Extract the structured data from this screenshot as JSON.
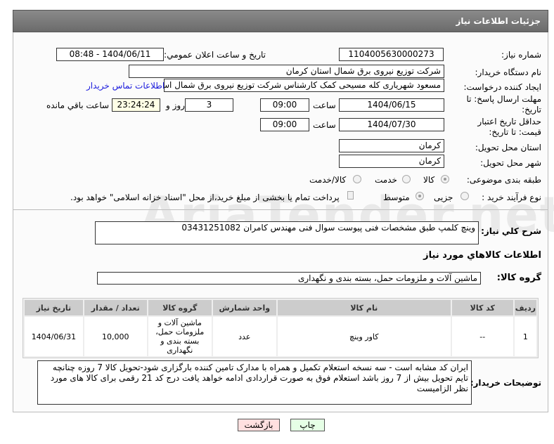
{
  "header": {
    "title": "جزئیات اطلاعات نیاز"
  },
  "fields": {
    "need_number_label": "شماره نیاز:",
    "need_number": "1104005630000273",
    "announce_label": "تاریخ و ساعت اعلان عمومي:",
    "announce_value": "1404/06/11 - 08:48",
    "buyer_label": "نام دستگاه خریدار:",
    "buyer": "شرکت توزیع نیروی برق شمال استان کرمان",
    "creator_label": "ایجاد کننده درخواست:",
    "creator": "مسعود شهریاری کله مسیحی کمک کارشناس شرکت توزیع نیروی برق شمال استان کرمان",
    "contact_link": "اطلاعات تماس خریدار",
    "deadline_label": "مهلت ارسال پاسخ: تا تاریخ:",
    "deadline_date": "1404/06/15",
    "time_label": "ساعت",
    "deadline_time": "09:00",
    "days": "3",
    "days_label": "روز و",
    "remaining": "23:24:24",
    "remaining_label": "ساعت باقي مانده",
    "validity_label": "حداقل تاریخ اعتبار قیمت: تا تاریخ:",
    "validity_date": "1404/07/30",
    "validity_time": "09:00",
    "province_label": "استان محل تحویل:",
    "province": "کرمان",
    "city_label": "شهر محل تحویل:",
    "city": "کرمان",
    "category_label": "طبقه بندی موضوعی:",
    "category_options": [
      "کالا",
      "خدمت",
      "کالا/خدمت"
    ],
    "category_selected": "کالا",
    "process_label": "نوع فرآیند خرید :",
    "process_options": [
      "جزیی",
      "متوسط"
    ],
    "process_selected": "متوسط",
    "payment_note": "پرداخت تمام یا بخشی از مبلغ خرید،از محل \"اسناد خزانه اسلامی\" خواهد بود.",
    "summary_label": "شرح كلي نياز:",
    "summary": "وینچ کلمپ طبق مشخصات فنی پیوست سوال فنی مهندس کامران 03431251082",
    "goods_title": "اطلاعات کالاهاي مورد نياز",
    "group_label": "گروه کالا:",
    "group": "ماشین آلات و ملزومات حمل، بسته بندی و نگهداری"
  },
  "table": {
    "headers": [
      "ردیف",
      "کد کالا",
      "نام کالا",
      "واحد شمارش",
      "گروه کالا",
      "تعداد / مقدار",
      "تاریخ نیاز"
    ],
    "rows": [
      [
        "1",
        "--",
        "کاور وینچ",
        "عدد",
        "ماشین آلات و ملزومات حمل، بسته بندی و نگهداری",
        "10,000",
        "1404/06/31"
      ]
    ]
  },
  "notes": {
    "label": "توضیحات خریدار:",
    "text": "ایران کد مشابه است - سه نسخه استعلام تکمیل و همراه با مدارک تامین کننده بارگزاری شود-تحویل کالا 7 روزه چنانچه تایم تحویل بیش از 7 روز باشد استعلام فوق به صورت قراردادی ادامه خواهد یافت  درج کد 21 رقمی برای کالا های مورد نظر الزامیست"
  },
  "buttons": {
    "print": "چاپ",
    "back": "بازگشت"
  },
  "watermark": "AriaTender.net"
}
